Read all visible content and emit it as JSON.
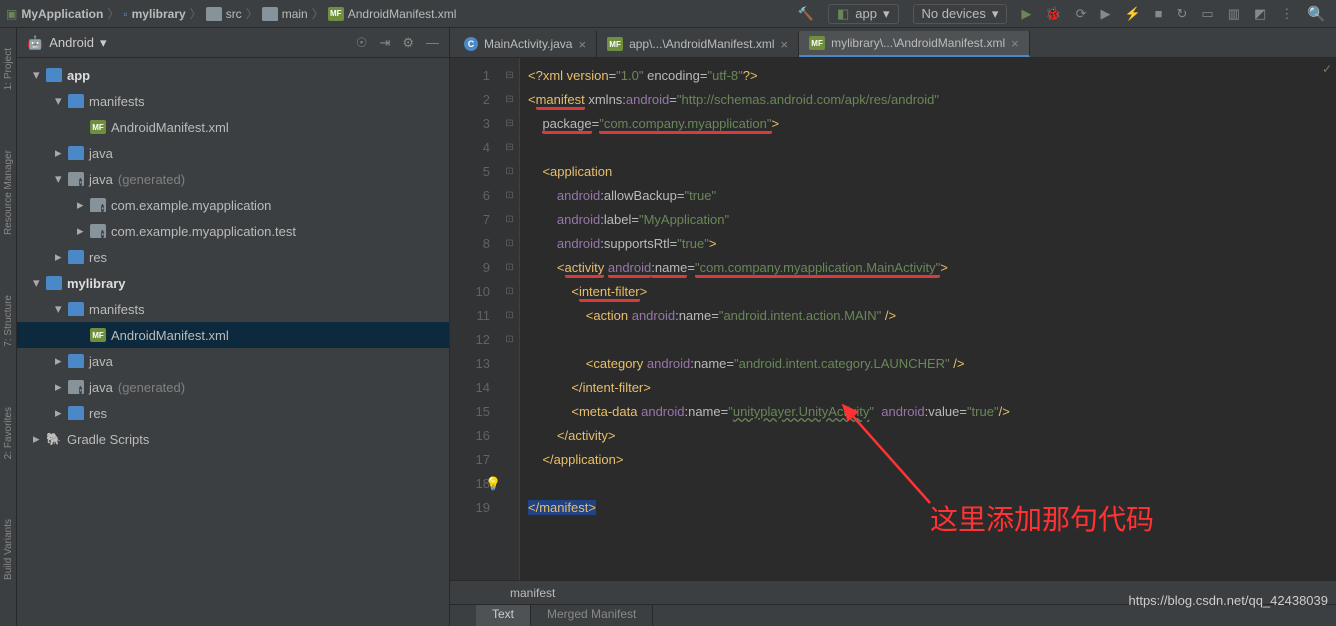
{
  "breadcrumb": [
    "MyApplication",
    "mylibrary",
    "src",
    "main",
    "AndroidManifest.xml"
  ],
  "run_config": {
    "app": "app",
    "device": "No devices"
  },
  "sidebar": {
    "header": "Android",
    "nodes": [
      {
        "indent": 0,
        "arrow": "▾",
        "icon": "folder-blue",
        "label": "app",
        "bold": true
      },
      {
        "indent": 1,
        "arrow": "▾",
        "icon": "folder-blue",
        "label": "manifests"
      },
      {
        "indent": 2,
        "arrow": "",
        "icon": "mf",
        "label": "AndroidManifest.xml"
      },
      {
        "indent": 1,
        "arrow": "▸",
        "icon": "folder-blue",
        "label": "java"
      },
      {
        "indent": 1,
        "arrow": "▾",
        "icon": "folder-pkg",
        "label": "java",
        "suffix": "(generated)"
      },
      {
        "indent": 2,
        "arrow": "▸",
        "icon": "folder-pkg",
        "label": "com.example.myapplication"
      },
      {
        "indent": 2,
        "arrow": "▸",
        "icon": "folder-pkg",
        "label": "com.example.myapplication.test"
      },
      {
        "indent": 1,
        "arrow": "▸",
        "icon": "folder-blue",
        "label": "res"
      },
      {
        "indent": 0,
        "arrow": "▾",
        "icon": "folder-blue",
        "label": "mylibrary",
        "bold": true
      },
      {
        "indent": 1,
        "arrow": "▾",
        "icon": "folder-blue",
        "label": "manifests"
      },
      {
        "indent": 2,
        "arrow": "",
        "icon": "mf",
        "label": "AndroidManifest.xml",
        "sel": true
      },
      {
        "indent": 1,
        "arrow": "▸",
        "icon": "folder-blue",
        "label": "java"
      },
      {
        "indent": 1,
        "arrow": "▸",
        "icon": "folder-pkg",
        "label": "java",
        "suffix": "(generated)"
      },
      {
        "indent": 1,
        "arrow": "▸",
        "icon": "folder-blue",
        "label": "res"
      },
      {
        "indent": 0,
        "arrow": "▸",
        "icon": "gradle",
        "label": "Gradle Scripts"
      }
    ]
  },
  "tabs": [
    {
      "icon": "java",
      "label": "MainActivity.java",
      "active": false
    },
    {
      "icon": "mf",
      "label": "app\\...\\AndroidManifest.xml",
      "active": false
    },
    {
      "icon": "mf",
      "label": "mylibrary\\...\\AndroidManifest.xml",
      "active": true
    }
  ],
  "lines": [
    1,
    2,
    3,
    4,
    5,
    6,
    7,
    8,
    9,
    10,
    11,
    12,
    13,
    14,
    15,
    16,
    17,
    18,
    19
  ],
  "bottom_breadcrumb": "manifest",
  "bottom_tabs": {
    "text": "Text",
    "merged": "Merged Manifest"
  },
  "annotation": "这里添加那句代码",
  "watermark": "https://blog.csdn.net/qq_42438039",
  "leftrail": [
    "1: Project",
    "Resource Manager",
    "7: Structure",
    "2: Favorites",
    "Build Variants"
  ],
  "code": {
    "l1_a": "<?",
    "l1_b": "xml version",
    "l1_c": "=",
    "l1_d": "\"1.0\"",
    "l1_e": " encoding",
    "l1_f": "=",
    "l1_g": "\"utf-8\"",
    "l1_h": "?>",
    "l2_a": "<",
    "l2_b": "manifest",
    "l2_c": " xmlns:",
    "l2_d": "android",
    "l2_e": "=",
    "l2_f": "\"http://schemas.android.com/apk/res/android\"",
    "l3_a": "package",
    "l3_b": "=",
    "l3_c": "\"com.company.myapplication\"",
    "l3_d": ">",
    "l5_a": "<",
    "l5_b": "application",
    "l6_a": "android",
    "l6_b": ":allowBackup",
    "l6_c": "=",
    "l6_d": "\"true\"",
    "l7_a": "android",
    "l7_b": ":label",
    "l7_c": "=",
    "l7_d": "\"MyApplication\"",
    "l8_a": "android",
    "l8_b": ":supportsRtl",
    "l8_c": "=",
    "l8_d": "\"true\"",
    "l8_e": ">",
    "l9_a": "<",
    "l9_b": "activity",
    "l9_c": " ",
    "l9_d": "android",
    "l9_e": ":name",
    "l9_f": "=",
    "l9_g": "\"com.company.myapplication.MainActivity\"",
    "l9_h": ">",
    "l10_a": "<",
    "l10_b": "intent-filter",
    "l10_c": ">",
    "l11_a": "<",
    "l11_b": "action",
    "l11_c": " ",
    "l11_d": "android",
    "l11_e": ":name",
    "l11_f": "=",
    "l11_g": "\"android.intent.action.MAIN\"",
    "l11_h": " />",
    "l13_a": "<",
    "l13_b": "category",
    "l13_c": " ",
    "l13_d": "android",
    "l13_e": ":name",
    "l13_f": "=",
    "l13_g": "\"android.intent.category.LAUNCHER\"",
    "l13_h": " />",
    "l14_a": "</",
    "l14_b": "intent-filter",
    "l14_c": ">",
    "l15_a": "<",
    "l15_b": "meta-data",
    "l15_c": " ",
    "l15_d": "android",
    "l15_e": ":name",
    "l15_f": "=",
    "l15_g": "\"",
    "l15_h": "unityplayer.UnityActivity",
    "l15_i": "\"",
    "l15_j": "  ",
    "l15_k": "android",
    "l15_l": ":value",
    "l15_m": "=",
    "l15_n": "\"true\"",
    "l15_o": "/>",
    "l16_a": "</",
    "l16_b": "activity",
    "l16_c": ">",
    "l17_a": "</",
    "l17_b": "application",
    "l17_c": ">",
    "l19_a": "</",
    "l19_b": "manifest",
    "l19_c": ">"
  }
}
